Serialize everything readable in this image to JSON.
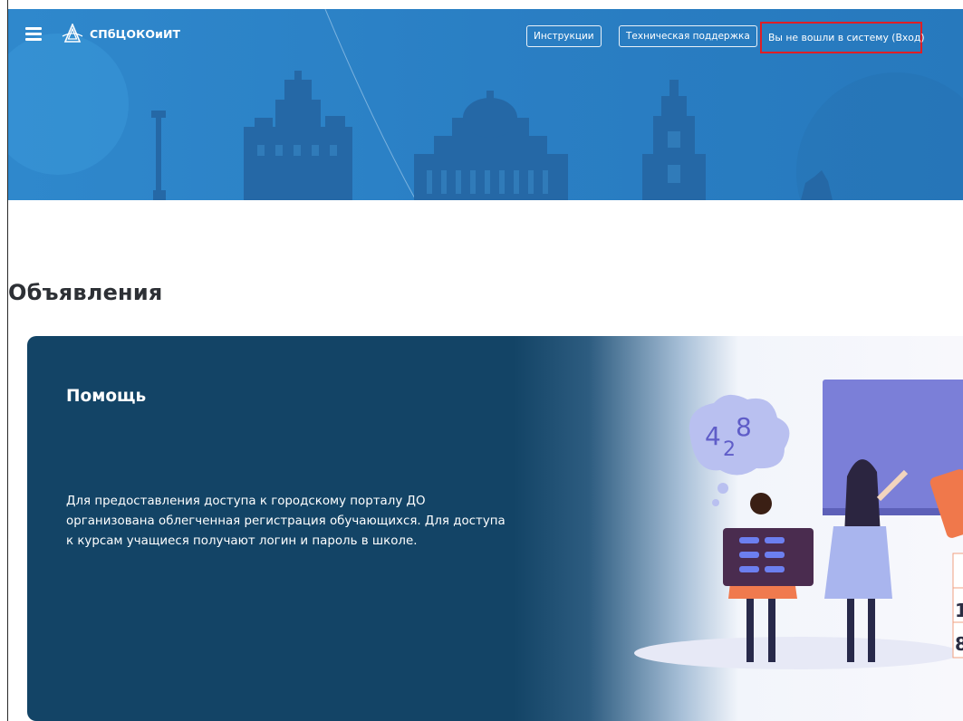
{
  "header": {
    "brand_text": "СПбЦОКОиИТ",
    "nav": {
      "instructions_label": "Инструкции",
      "support_label": "Техническая поддержка",
      "login_label": "Вы не вошли в систему (Вход)"
    },
    "icons": {
      "menu": "hamburger-menu-icon",
      "logo": "spbcokoit-logo-icon"
    }
  },
  "section": {
    "title": "Объявления"
  },
  "announcement": {
    "title": "Помощь",
    "body": "Для предоставления доступа к городскому порталу ДО организована облегченная регистрация обучающихся. Для доступа к курсам учащиеся получают логин и пароль в школе.",
    "illustration": {
      "bubble_text_a": "4",
      "bubble_text_b": "2",
      "bubble_text_c": "8",
      "table_digit_1": "1",
      "table_digit_2": "8"
    }
  },
  "colors": {
    "header_bg": "#2a7fc4",
    "card_bg": "#134466",
    "login_highlight": "#e01e25",
    "title_text": "#2d3035"
  }
}
